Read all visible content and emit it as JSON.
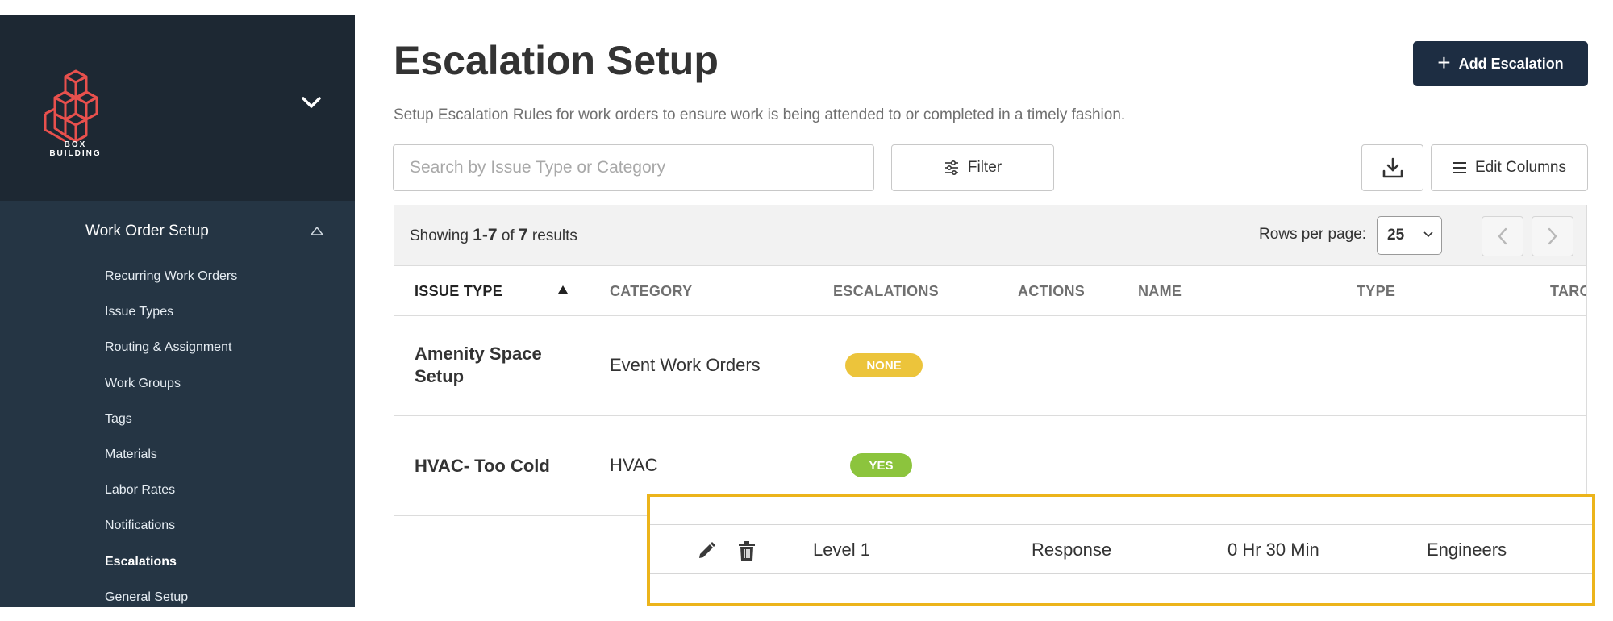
{
  "brand": {
    "name": "BOX BUILDING",
    "accent": "#e8504d"
  },
  "sidebar": {
    "group_label": "Work Order Setup",
    "items": [
      {
        "label": "Recurring Work Orders",
        "active": false
      },
      {
        "label": "Issue Types",
        "active": false
      },
      {
        "label": "Routing & Assignment",
        "active": false
      },
      {
        "label": "Work Groups",
        "active": false
      },
      {
        "label": "Tags",
        "active": false
      },
      {
        "label": "Materials",
        "active": false
      },
      {
        "label": "Labor Rates",
        "active": false
      },
      {
        "label": "Notifications",
        "active": false
      },
      {
        "label": "Escalations",
        "active": true
      },
      {
        "label": "General Setup",
        "active": false
      }
    ]
  },
  "page": {
    "title": "Escalation Setup",
    "subtitle": "Setup Escalation Rules for work orders to ensure work is being attended to or completed in a timely fashion.",
    "add_button": "Add Escalation"
  },
  "toolbar": {
    "search_placeholder": "Search by Issue Type or Category",
    "filter_label": "Filter",
    "edit_columns_label": "Edit Columns"
  },
  "pagination": {
    "showing_prefix": "Showing",
    "range": "1-7",
    "of_word": "of",
    "total": "7",
    "results_word": "results",
    "rows_per_page_label": "Rows per page:",
    "rows_per_page_value": "25"
  },
  "table": {
    "columns": [
      "ISSUE TYPE",
      "CATEGORY",
      "ESCALATIONS",
      "ACTIONS",
      "NAME",
      "TYPE",
      "TARG"
    ],
    "sorted_column": "ISSUE TYPE",
    "rows": [
      {
        "issue_type": "Amenity Space Setup",
        "category": "Event Work Orders",
        "escalations": "NONE"
      },
      {
        "issue_type": "HVAC- Too Cold",
        "category": "HVAC",
        "escalations": "YES"
      }
    ],
    "expanded_escalation": {
      "name": "Level 1",
      "type": "Response",
      "target": "0 Hr 30 Min",
      "group": "Engineers"
    }
  },
  "colors": {
    "sidebar_bg": "#253544",
    "brand_bg": "#1d2833",
    "primary_button": "#1d2d42",
    "badge_none": "#ecc43b",
    "badge_yes": "#8cc43d",
    "highlight_border": "#ecb41b"
  }
}
